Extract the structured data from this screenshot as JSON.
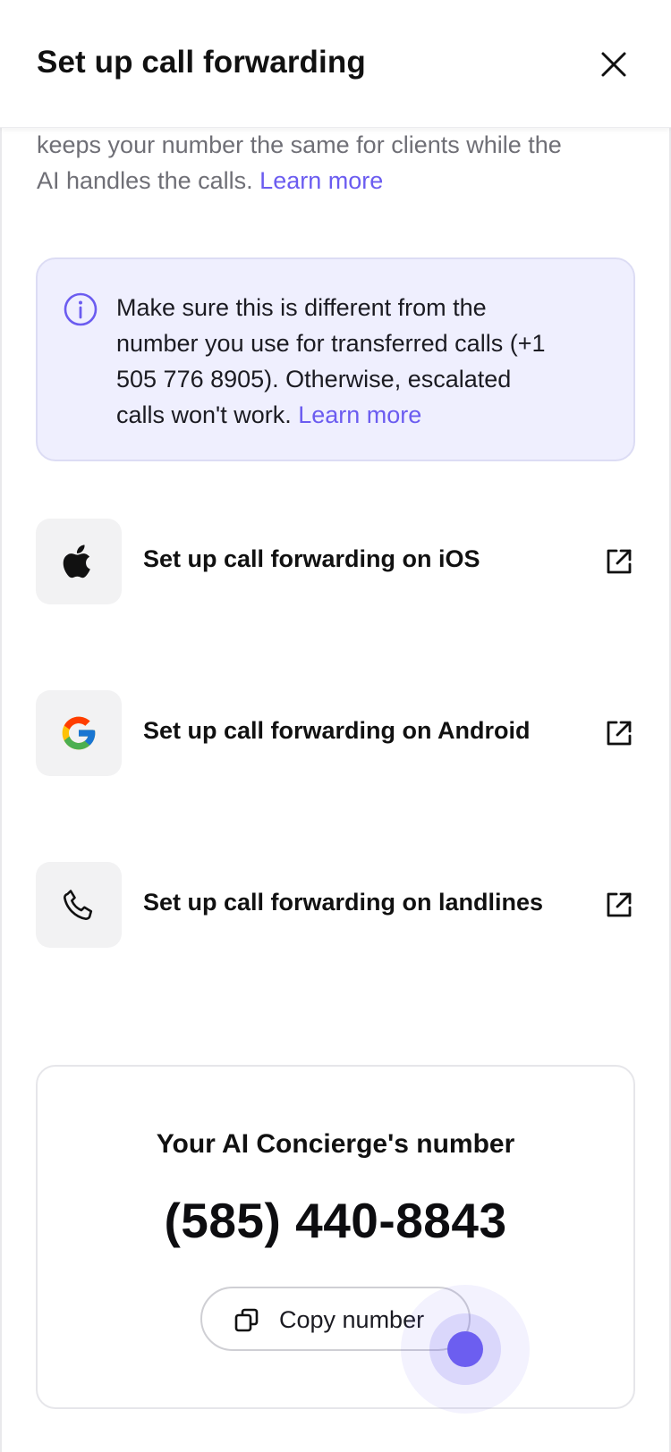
{
  "header": {
    "title": "Set up call forwarding",
    "close_icon": "close-icon"
  },
  "intro": {
    "line1": "keeps your number the same for clients while the",
    "line2": "AI handles the calls.",
    "link": "Learn more"
  },
  "callout": {
    "icon": "info-icon",
    "line1": "Make sure this is different from the",
    "line2": "number you use for transferred calls (+1",
    "line3": "505 776 8905). Otherwise, escalated",
    "line4": "calls won't work.",
    "link": "Learn more"
  },
  "options": [
    {
      "icon": "apple-icon",
      "label": "Set up call forwarding on iOS",
      "action_icon": "external-link-icon"
    },
    {
      "icon": "google-icon",
      "label": "Set up call forwarding on Android",
      "action_icon": "external-link-icon"
    },
    {
      "icon": "phone-icon",
      "label": "Set up call forwarding on landlines",
      "action_icon": "external-link-icon"
    }
  ],
  "number_card": {
    "title": "Your AI Concierge's number",
    "number": "(585) 440-8843",
    "copy_button": "Copy number",
    "copy_icon": "copy-icon"
  },
  "colors": {
    "accent": "#6b5cf0",
    "callout_bg": "#efeffe",
    "tile_bg": "#f2f2f3",
    "muted_text": "#6f6f76"
  }
}
